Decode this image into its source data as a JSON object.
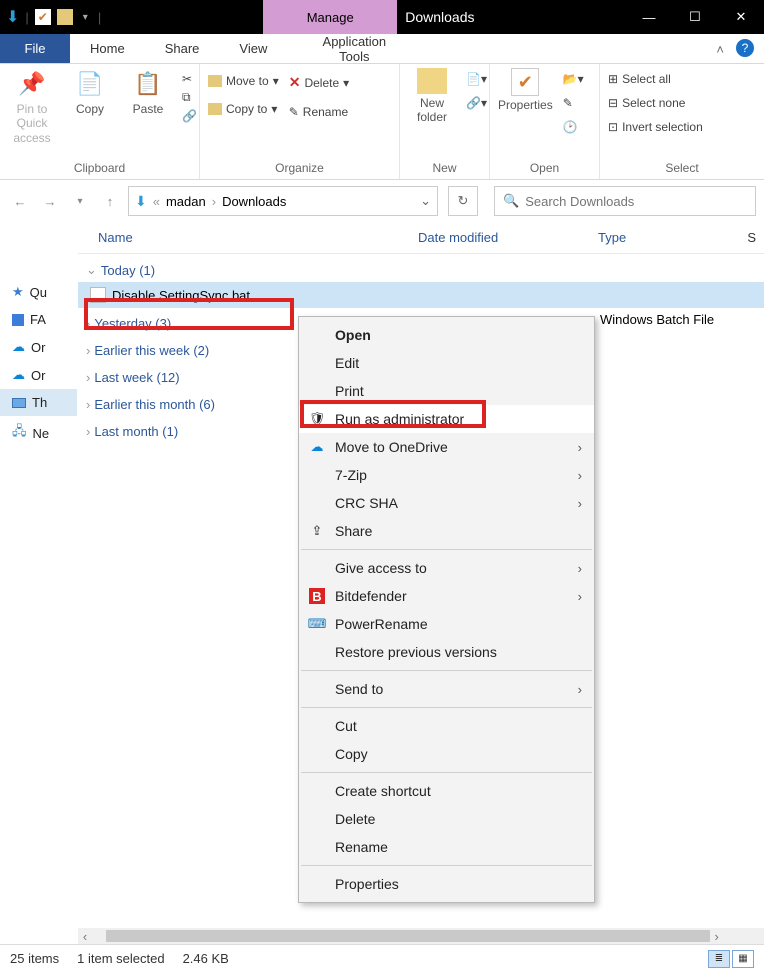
{
  "titlebar": {
    "manage_tab": "Manage",
    "folder_title": "Downloads"
  },
  "menutabs": {
    "file": "File",
    "home": "Home",
    "share": "Share",
    "view": "View",
    "application_tools": "Application Tools"
  },
  "ribbon": {
    "clipboard": {
      "label": "Clipboard",
      "pin": "Pin to Quick access",
      "copy": "Copy",
      "paste": "Paste"
    },
    "organize": {
      "label": "Organize",
      "move_to": "Move to",
      "copy_to": "Copy to",
      "delete": "Delete",
      "rename": "Rename"
    },
    "new": {
      "label": "New",
      "new_folder": "New folder"
    },
    "open": {
      "label": "Open",
      "properties": "Properties"
    },
    "select": {
      "label": "Select",
      "select_all": "Select all",
      "select_none": "Select none",
      "invert": "Invert selection"
    }
  },
  "addressbar": {
    "segment1": "madan",
    "segment2": "Downloads"
  },
  "search": {
    "placeholder": "Search Downloads"
  },
  "columns": {
    "name": "Name",
    "date": "Date modified",
    "type": "Type",
    "s": "S"
  },
  "sidebar": {
    "items": [
      {
        "label": "Qu"
      },
      {
        "label": "FA"
      },
      {
        "label": "Or"
      },
      {
        "label": "Or"
      },
      {
        "label": "Th"
      },
      {
        "label": "Ne"
      }
    ]
  },
  "groups": [
    {
      "label": "Today (1)",
      "expanded": true
    },
    {
      "label": "Yesterday (3)",
      "expanded": false
    },
    {
      "label": "Earlier this week (2)",
      "expanded": false
    },
    {
      "label": "Last week (12)",
      "expanded": false
    },
    {
      "label": "Earlier this month (6)",
      "expanded": false
    },
    {
      "label": "Last month (1)",
      "expanded": false
    }
  ],
  "file": {
    "name": "Disable SettingSync.bat",
    "type": "Windows Batch File"
  },
  "context_menu": {
    "open": "Open",
    "edit": "Edit",
    "print": "Print",
    "run_admin": "Run as administrator",
    "move_onedrive": "Move to OneDrive",
    "seven_zip": "7-Zip",
    "crc_sha": "CRC SHA",
    "share": "Share",
    "give_access": "Give access to",
    "bitdefender": "Bitdefender",
    "powerrename": "PowerRename",
    "restore": "Restore previous versions",
    "send_to": "Send to",
    "cut": "Cut",
    "copy": "Copy",
    "create_shortcut": "Create shortcut",
    "delete": "Delete",
    "rename": "Rename",
    "properties": "Properties"
  },
  "statusbar": {
    "count": "25 items",
    "selected": "1 item selected",
    "size": "2.46 KB"
  }
}
